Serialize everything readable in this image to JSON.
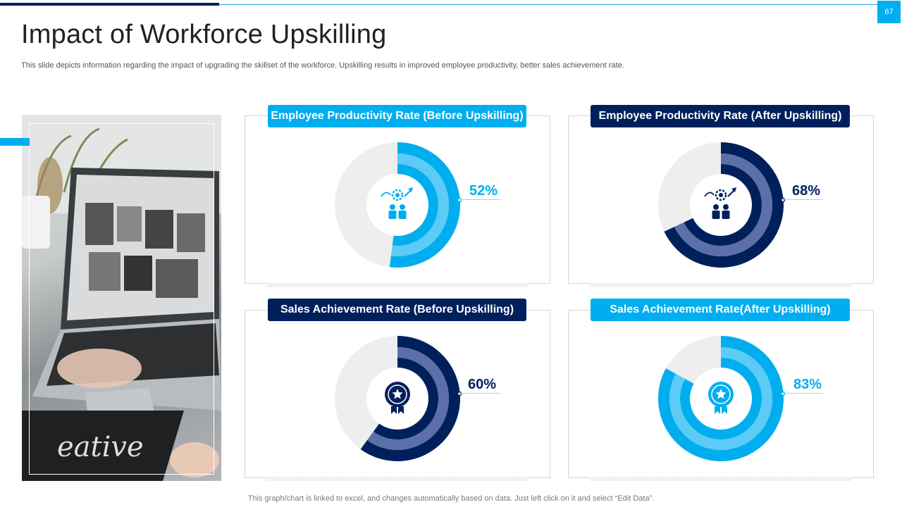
{
  "slide": {
    "page_number": "67",
    "title": "Impact of Workforce Upskilling",
    "subtitle": "This slide depicts information regarding the impact of upgrading the skillset of the workforce. Upskilling results in improved employee productivity, better sales achievement rate.",
    "footer_note": "This graph/chart is linked to excel,  and changes automatically based on data. Just left click on it and select “Edit Data”."
  },
  "colors": {
    "light_blue": "#00aeef",
    "medium_blue": "#5ccbf5",
    "navy": "#00205b",
    "slate": "#5b6fa8",
    "track": "#eeeeee"
  },
  "chart_data": [
    {
      "type": "pie",
      "title": "Employee Productivity Rate (Before Upskilling)",
      "value": 52,
      "value_label": "52%",
      "icon": "productivity-icon",
      "theme": "light"
    },
    {
      "type": "pie",
      "title": "Employee Productivity Rate (After Upskilling)",
      "value": 68,
      "value_label": "68%",
      "icon": "productivity-icon",
      "theme": "navy"
    },
    {
      "type": "pie",
      "title": "Sales Achievement Rate (Before Upskilling)",
      "value": 60,
      "value_label": "60%",
      "icon": "award-icon",
      "theme": "navy"
    },
    {
      "type": "pie",
      "title": "Sales Achievement Rate(After Upskilling)",
      "value": 83,
      "value_label": "83%",
      "icon": "award-icon",
      "theme": "light"
    }
  ]
}
